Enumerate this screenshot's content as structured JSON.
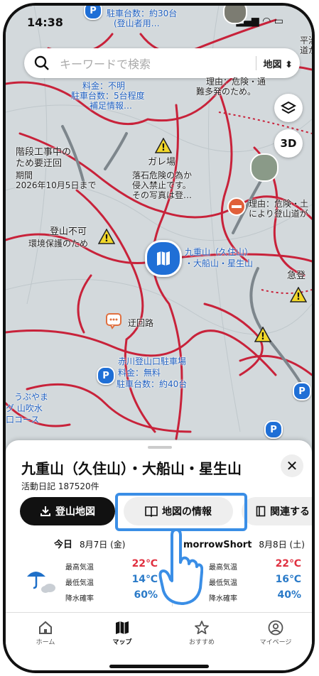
{
  "status_bar": {
    "time": "14:38",
    "icons": "▂▄▆ ◠ ▭"
  },
  "search": {
    "placeholder": "キーワードで検索",
    "layer_label": "地図"
  },
  "map_buttons": {
    "three_d": "3D"
  },
  "map_labels": {
    "parking_top": "駐車台数：約30台",
    "parking_top2": "(登山者用…",
    "fee_unknown": "料金：不明",
    "parking_count": "駐車台数：5台程度",
    "parking_info": "補足情報…",
    "danger1": "理由：危険・通",
    "danger1b": "難多発のため。",
    "construction": "階段工事中の",
    "construction2": "ため要迂回",
    "period": "期間",
    "period_date": "2026年10月5日まで",
    "gare": "ガレ場",
    "gare1": "落石危険の為か",
    "gare2": "侵入禁止です。",
    "gare3": "その写真は登…",
    "danger2": "理由：危険・土",
    "danger2b": "により登山道が",
    "closed": "登山不可",
    "closed_reason": "環境保護のため",
    "mountain": "九重山（久住山）",
    "mountain2": "・大船山・星生山",
    "steep": "急登",
    "detour": "迂回路",
    "akagawa": "赤川登山口駐車場",
    "akagawa_fee": "料金：無料",
    "akagawa_count": "駐車台数：約40台",
    "uf1": "うぶやま",
    "uf2": "グ 山吹水",
    "uf3": "口コース",
    "ri1": "平治",
    "ri2": "道が",
    "parking_letter": "P"
  },
  "sheet": {
    "title": "九重山（久住山）・大船山・星生山",
    "records": "活動日記 187520件",
    "buttons": {
      "download": "登山地図",
      "map_info": "地図の情報",
      "related": "関連する"
    },
    "close": "✕"
  },
  "weather": {
    "today": {
      "label": "今日",
      "date": "8月7日 (金)",
      "max_label": "最高気温",
      "max": "22℃",
      "min_label": "最低気温",
      "min": "14℃",
      "rain_label": "降水確率",
      "rain": "60%"
    },
    "tomorrow": {
      "label": "morrowShort",
      "date": "8月8日 (土)",
      "max_label": "最高気温",
      "max": "22℃",
      "min_label": "最低気温",
      "min": "16℃",
      "rain_label": "降水確率",
      "rain": "40%"
    }
  },
  "tabs": [
    {
      "label": "ホーム",
      "icon": "home-icon"
    },
    {
      "label": "マップ",
      "icon": "map-icon"
    },
    {
      "label": "おすすめ",
      "icon": "star-icon"
    },
    {
      "label": "マイページ",
      "icon": "user-icon"
    }
  ],
  "colors": {
    "trail_red": "#c8223a",
    "accent_blue": "#3a8ee6",
    "temp_red": "#e03040",
    "temp_blue": "#2a7ac8"
  }
}
